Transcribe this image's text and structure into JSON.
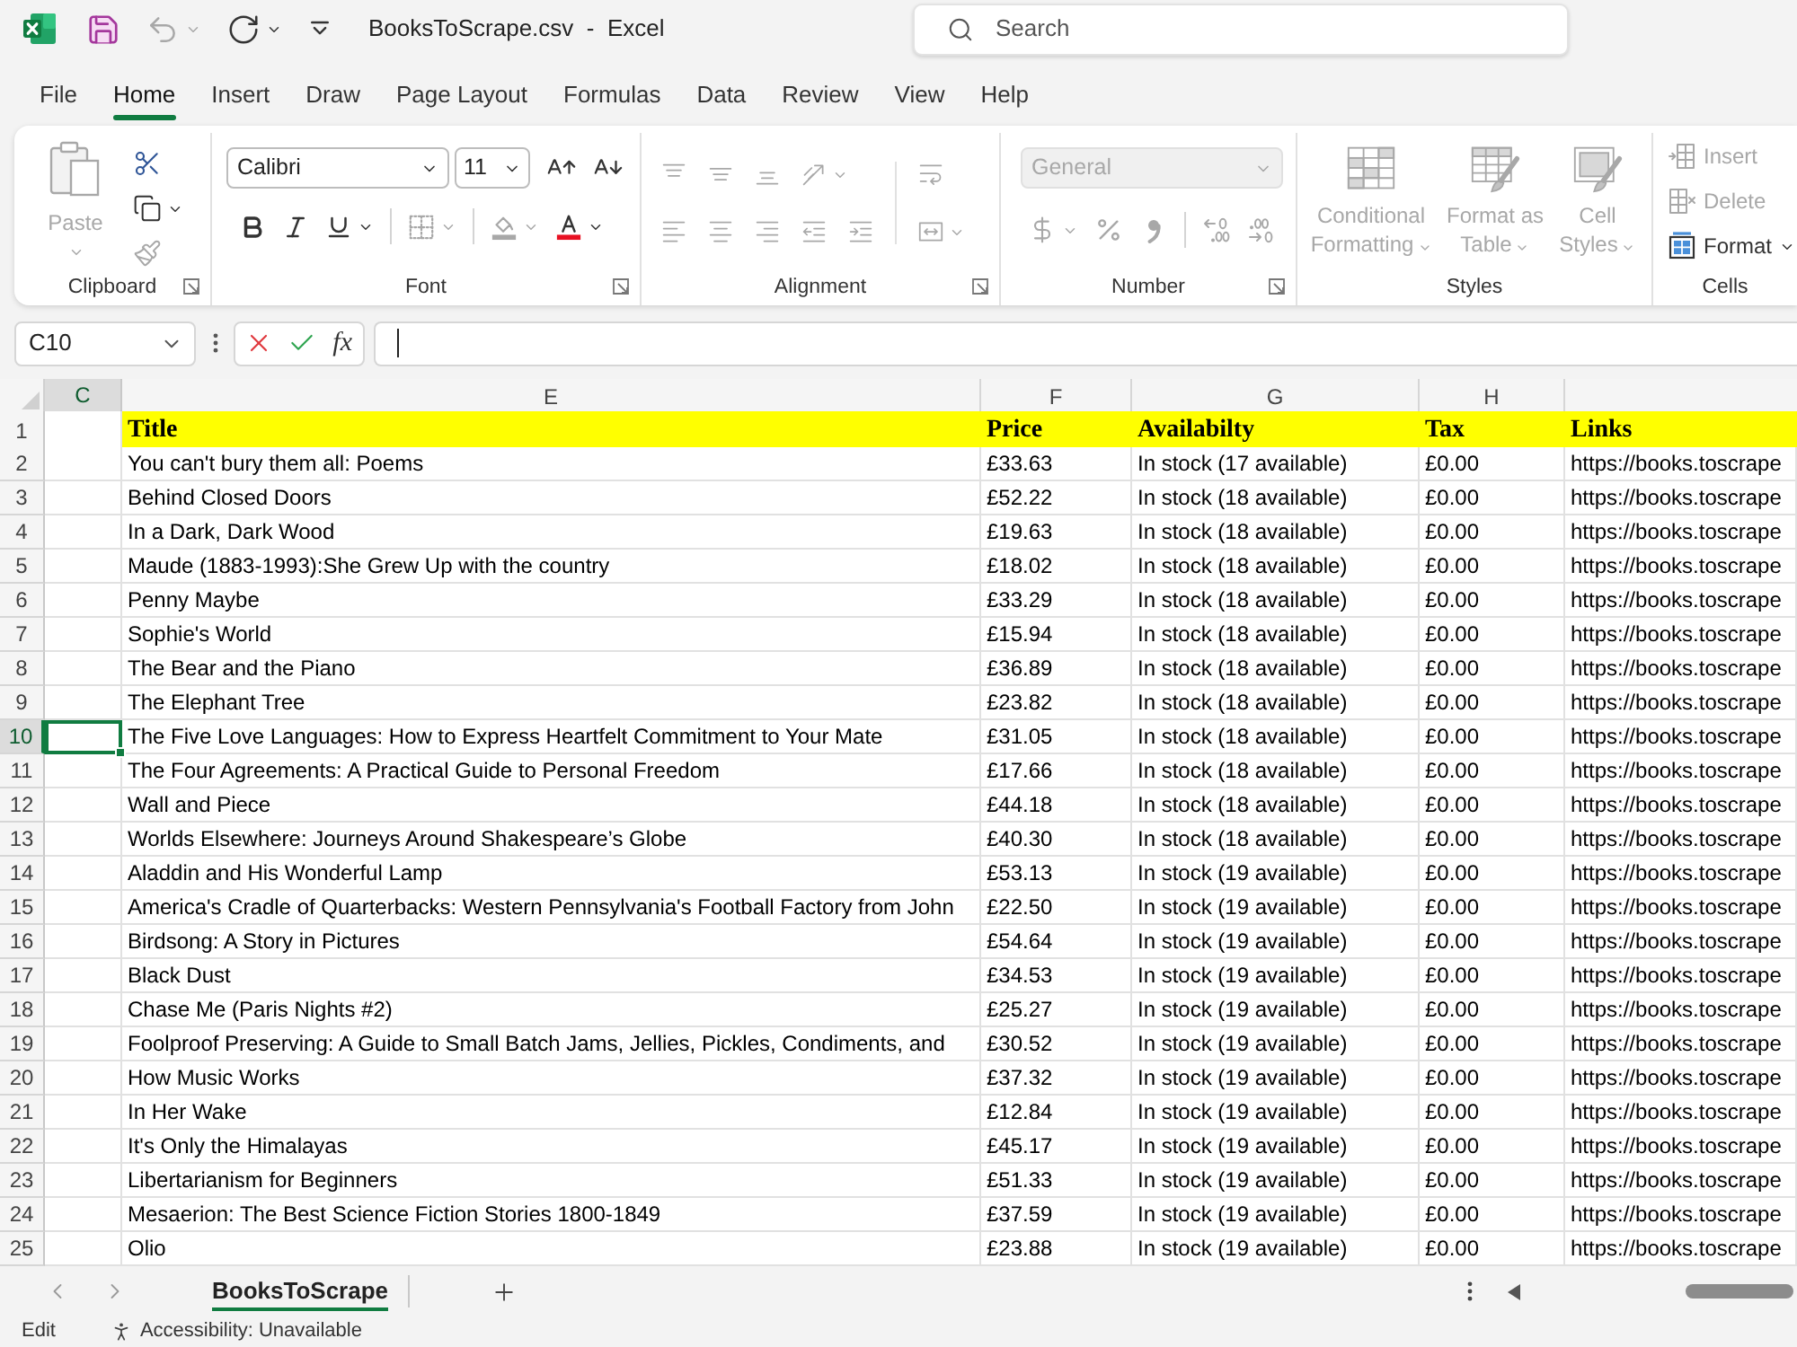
{
  "title_bar": {
    "quick_access": [
      {
        "kind": "save",
        "disabled": false,
        "dropdown": false
      },
      {
        "kind": "undo",
        "disabled": true,
        "dropdown": true
      },
      {
        "kind": "redo",
        "disabled": false,
        "dropdown": true
      },
      {
        "kind": "customize",
        "disabled": false,
        "dropdown": false
      }
    ],
    "title": "BooksToScrape.csv  -  Excel",
    "search": {
      "placeholder": "Search"
    }
  },
  "menu_tabs": [
    {
      "label": "File",
      "selected": false
    },
    {
      "label": "Home",
      "selected": true
    },
    {
      "label": "Insert",
      "selected": false
    },
    {
      "label": "Draw",
      "selected": false
    },
    {
      "label": "Page Layout",
      "selected": false
    },
    {
      "label": "Formulas",
      "selected": false
    },
    {
      "label": "Data",
      "selected": false
    },
    {
      "label": "Review",
      "selected": false
    },
    {
      "label": "View",
      "selected": false
    },
    {
      "label": "Help",
      "selected": false
    }
  ],
  "ribbon": {
    "groups": [
      {
        "kind": "clipboard",
        "label": "Clipboard",
        "dialog_launcher": true,
        "paste": {
          "label": "Paste",
          "disabled": true
        },
        "tools": [
          {
            "kind": "cut",
            "disabled": false,
            "dropdown": false
          },
          {
            "kind": "copy",
            "disabled": false,
            "dropdown": true
          },
          {
            "kind": "format_painter",
            "disabled": true,
            "dropdown": false
          }
        ]
      },
      {
        "kind": "font",
        "label": "Font",
        "dialog_launcher": true,
        "font_name": "Calibri",
        "font_size": "11",
        "row_1": [
          {
            "kind": "grow_font",
            "disabled": false,
            "dropdown": false
          },
          {
            "kind": "shrink_font",
            "disabled": false,
            "dropdown": false
          }
        ],
        "row_2": [
          {
            "kind": "bold",
            "disabled": false,
            "dropdown": false
          },
          {
            "kind": "italic",
            "disabled": false,
            "dropdown": false
          },
          {
            "kind": "underline",
            "disabled": false,
            "dropdown": true
          },
          {
            "kind": "borders",
            "disabled": true,
            "dropdown": true
          },
          {
            "kind": "fill_color",
            "disabled": true,
            "dropdown": true
          },
          {
            "kind": "font_color",
            "disabled": false,
            "dropdown": true
          }
        ]
      },
      {
        "kind": "alignment",
        "label": "Alignment",
        "dialog_launcher": true,
        "row_1": [
          {
            "kind": "top_align",
            "disabled": true,
            "dropdown": false
          },
          {
            "kind": "middle_align",
            "disabled": true,
            "dropdown": false
          },
          {
            "kind": "bottom_align",
            "disabled": true,
            "dropdown": false
          },
          {
            "kind": "orientation",
            "disabled": true,
            "dropdown": true
          }
        ],
        "row_2": [
          {
            "kind": "left_align",
            "disabled": true,
            "dropdown": false
          },
          {
            "kind": "center_align",
            "disabled": true,
            "dropdown": false
          },
          {
            "kind": "right_align",
            "disabled": true,
            "dropdown": false
          },
          {
            "kind": "decrease_indent",
            "disabled": true,
            "dropdown": false
          },
          {
            "kind": "increase_indent",
            "disabled": true,
            "dropdown": false
          }
        ],
        "side": [
          {
            "kind": "wrap_text",
            "disabled": true,
            "dropdown": false
          },
          {
            "kind": "merge",
            "disabled": true,
            "dropdown": true
          }
        ]
      },
      {
        "kind": "number",
        "label": "Number",
        "dialog_launcher": true,
        "format": {
          "value": "General",
          "disabled": true
        },
        "row_2": [
          {
            "kind": "currency",
            "disabled": true,
            "dropdown": true
          },
          {
            "kind": "percent",
            "disabled": true,
            "dropdown": false
          },
          {
            "kind": "comma",
            "disabled": true,
            "dropdown": false
          },
          {
            "kind": "increase_decimal",
            "disabled": true,
            "dropdown": false
          },
          {
            "kind": "decrease_decimal",
            "disabled": true,
            "dropdown": false
          }
        ]
      },
      {
        "kind": "styles",
        "label": "Styles",
        "dialog_launcher": false,
        "buttons": [
          {
            "kind": "conditional_formatting",
            "label": "Conditional Formatting",
            "disabled": true,
            "dropdown": true
          },
          {
            "kind": "format_as_table",
            "label": "Format as Table",
            "disabled": true,
            "dropdown": true
          },
          {
            "kind": "cell_styles",
            "label": "Cell Styles",
            "disabled": true,
            "dropdown": true
          }
        ]
      },
      {
        "kind": "cells",
        "label": "Cells",
        "dialog_launcher": false,
        "buttons": [
          {
            "kind": "insert",
            "label": "Insert",
            "disabled": true,
            "dropdown": false
          },
          {
            "kind": "delete",
            "label": "Delete",
            "disabled": true,
            "dropdown": false
          },
          {
            "kind": "format",
            "label": "Format",
            "disabled": false,
            "dropdown": true
          }
        ]
      }
    ]
  },
  "formula_bar": {
    "name_box": "C10",
    "function_button": "fx",
    "editing": true
  },
  "sheet": {
    "column_headers": [
      {
        "label": "C",
        "selected": true
      },
      {
        "label": "E",
        "selected": false
      },
      {
        "label": "F",
        "selected": false
      },
      {
        "label": "G",
        "selected": false
      },
      {
        "label": "H",
        "selected": false
      }
    ],
    "rows": [
      {
        "number": "1",
        "kind": "header",
        "selected": false,
        "title": "Title",
        "price": "Price",
        "availability": "Availabilty",
        "tax": "Tax",
        "link": "Links"
      },
      {
        "number": "2",
        "kind": "data",
        "selected": false,
        "title": "You can't bury them all: Poems",
        "price": "£33.63",
        "availability": "In stock (17 available)",
        "tax": "£0.00",
        "link": "https://books.toscrape"
      },
      {
        "number": "3",
        "kind": "data",
        "selected": false,
        "title": "Behind Closed Doors",
        "price": "£52.22",
        "availability": "In stock (18 available)",
        "tax": "£0.00",
        "link": "https://books.toscrape"
      },
      {
        "number": "4",
        "kind": "data",
        "selected": false,
        "title": "In a Dark, Dark Wood",
        "price": "£19.63",
        "availability": "In stock (18 available)",
        "tax": "£0.00",
        "link": "https://books.toscrape"
      },
      {
        "number": "5",
        "kind": "data",
        "selected": false,
        "title": "Maude (1883-1993):She Grew Up with the country",
        "price": "£18.02",
        "availability": "In stock (18 available)",
        "tax": "£0.00",
        "link": "https://books.toscrape"
      },
      {
        "number": "6",
        "kind": "data",
        "selected": false,
        "title": "Penny Maybe",
        "price": "£33.29",
        "availability": "In stock (18 available)",
        "tax": "£0.00",
        "link": "https://books.toscrape"
      },
      {
        "number": "7",
        "kind": "data",
        "selected": false,
        "title": "Sophie's World",
        "price": "£15.94",
        "availability": "In stock (18 available)",
        "tax": "£0.00",
        "link": "https://books.toscrape"
      },
      {
        "number": "8",
        "kind": "data",
        "selected": false,
        "title": "The Bear and the Piano",
        "price": "£36.89",
        "availability": "In stock (18 available)",
        "tax": "£0.00",
        "link": "https://books.toscrape"
      },
      {
        "number": "9",
        "kind": "data",
        "selected": false,
        "title": "The Elephant Tree",
        "price": "£23.82",
        "availability": "In stock (18 available)",
        "tax": "£0.00",
        "link": "https://books.toscrape"
      },
      {
        "number": "10",
        "kind": "data",
        "selected": true,
        "title": "The Five Love Languages: How to Express Heartfelt Commitment to Your Mate",
        "price": "£31.05",
        "availability": "In stock (18 available)",
        "tax": "£0.00",
        "link": "https://books.toscrape"
      },
      {
        "number": "11",
        "kind": "data",
        "selected": false,
        "title": "The Four Agreements: A Practical Guide to Personal Freedom",
        "price": "£17.66",
        "availability": "In stock (18 available)",
        "tax": "£0.00",
        "link": "https://books.toscrape"
      },
      {
        "number": "12",
        "kind": "data",
        "selected": false,
        "title": "Wall and Piece",
        "price": "£44.18",
        "availability": "In stock (18 available)",
        "tax": "£0.00",
        "link": "https://books.toscrape"
      },
      {
        "number": "13",
        "kind": "data",
        "selected": false,
        "title": "Worlds Elsewhere: Journeys Around Shakespeare’s Globe",
        "price": "£40.30",
        "availability": "In stock (18 available)",
        "tax": "£0.00",
        "link": "https://books.toscrape"
      },
      {
        "number": "14",
        "kind": "data",
        "selected": false,
        "title": "Aladdin and His Wonderful Lamp",
        "price": "£53.13",
        "availability": "In stock (19 available)",
        "tax": "£0.00",
        "link": "https://books.toscrape"
      },
      {
        "number": "15",
        "kind": "data",
        "selected": false,
        "title": "America's Cradle of Quarterbacks: Western Pennsylvania's Football Factory from John",
        "price": "£22.50",
        "availability": "In stock (19 available)",
        "tax": "£0.00",
        "link": "https://books.toscrape"
      },
      {
        "number": "16",
        "kind": "data",
        "selected": false,
        "title": "Birdsong: A Story in Pictures",
        "price": "£54.64",
        "availability": "In stock (19 available)",
        "tax": "£0.00",
        "link": "https://books.toscrape"
      },
      {
        "number": "17",
        "kind": "data",
        "selected": false,
        "title": "Black Dust",
        "price": "£34.53",
        "availability": "In stock (19 available)",
        "tax": "£0.00",
        "link": "https://books.toscrape"
      },
      {
        "number": "18",
        "kind": "data",
        "selected": false,
        "title": "Chase Me (Paris Nights #2)",
        "price": "£25.27",
        "availability": "In stock (19 available)",
        "tax": "£0.00",
        "link": "https://books.toscrape"
      },
      {
        "number": "19",
        "kind": "data",
        "selected": false,
        "title": "Foolproof Preserving: A Guide to Small Batch Jams, Jellies, Pickles, Condiments, and",
        "price": "£30.52",
        "availability": "In stock (19 available)",
        "tax": "£0.00",
        "link": "https://books.toscrape"
      },
      {
        "number": "20",
        "kind": "data",
        "selected": false,
        "title": "How Music Works",
        "price": "£37.32",
        "availability": "In stock (19 available)",
        "tax": "£0.00",
        "link": "https://books.toscrape"
      },
      {
        "number": "21",
        "kind": "data",
        "selected": false,
        "title": "In Her Wake",
        "price": "£12.84",
        "availability": "In stock (19 available)",
        "tax": "£0.00",
        "link": "https://books.toscrape"
      },
      {
        "number": "22",
        "kind": "data",
        "selected": false,
        "title": "It's Only the Himalayas",
        "price": "£45.17",
        "availability": "In stock (19 available)",
        "tax": "£0.00",
        "link": "https://books.toscrape"
      },
      {
        "number": "23",
        "kind": "data",
        "selected": false,
        "title": "Libertarianism for Beginners",
        "price": "£51.33",
        "availability": "In stock (19 available)",
        "tax": "£0.00",
        "link": "https://books.toscrape"
      },
      {
        "number": "24",
        "kind": "data",
        "selected": false,
        "title": "Mesaerion: The Best Science Fiction Stories 1800-1849",
        "price": "£37.59",
        "availability": "In stock (19 available)",
        "tax": "£0.00",
        "link": "https://books.toscrape"
      },
      {
        "number": "25",
        "kind": "data",
        "selected": false,
        "title": "Olio",
        "price": "£23.88",
        "availability": "In stock (19 available)",
        "tax": "£0.00",
        "link": "https://books.toscrape"
      }
    ]
  },
  "sheet_tabs": [
    {
      "label": "BooksToScrape",
      "selected": true
    }
  ],
  "status_bar": {
    "mode": "Edit",
    "accessibility": "Accessibility: Unavailable"
  }
}
